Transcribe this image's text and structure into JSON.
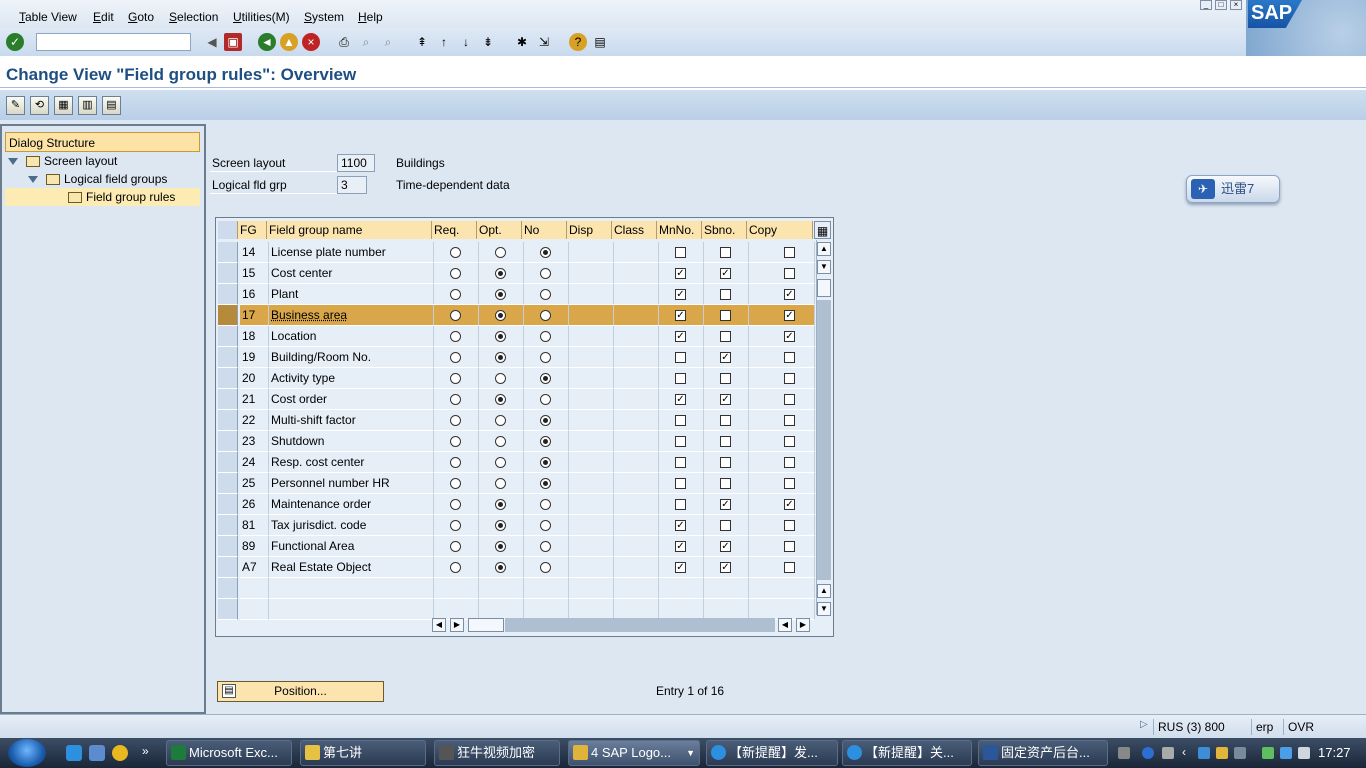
{
  "menu": {
    "items": [
      "Table View",
      "Edit",
      "Goto",
      "Selection",
      "Utilities(M)",
      "System",
      "Help"
    ]
  },
  "brand": {
    "logo_text": "SAP",
    "accent": "#1f4f82"
  },
  "title": "Change View \"Field group rules\": Overview",
  "dialog_structure": {
    "header": "Dialog Structure",
    "items": [
      {
        "label": "Screen layout",
        "level": 0
      },
      {
        "label": "Logical field groups",
        "level": 1
      },
      {
        "label": "Field group rules",
        "level": 2,
        "selected": true
      }
    ]
  },
  "form": {
    "screen_layout_label": "Screen layout",
    "screen_layout_value": "1100",
    "screen_layout_desc": "Buildings",
    "logical_grp_label": "Logical fld grp",
    "logical_grp_value": "3",
    "logical_grp_desc": "Time-dependent data"
  },
  "xunlei": {
    "label": "迅雷7"
  },
  "table": {
    "columns": [
      "FG",
      "Field group name",
      "Req.",
      "Opt.",
      "No",
      "Disp",
      "Class",
      "MnNo.",
      "Sbno.",
      "Copy"
    ],
    "rows": [
      {
        "fg": "14",
        "name": "License plate number",
        "radio": "no",
        "mn": false,
        "sb": false,
        "copy": false
      },
      {
        "fg": "15",
        "name": "Cost center",
        "radio": "opt",
        "mn": true,
        "sb": true,
        "copy": false
      },
      {
        "fg": "16",
        "name": "Plant",
        "radio": "opt",
        "mn": true,
        "sb": false,
        "copy": true
      },
      {
        "fg": "17",
        "name": "Business area",
        "radio": "opt",
        "mn": true,
        "sb": false,
        "copy": true,
        "highlight": true
      },
      {
        "fg": "18",
        "name": "Location",
        "radio": "opt",
        "mn": true,
        "sb": false,
        "copy": true
      },
      {
        "fg": "19",
        "name": "Building/Room No.",
        "radio": "opt",
        "mn": false,
        "sb": true,
        "copy": false
      },
      {
        "fg": "20",
        "name": "Activity type",
        "radio": "no",
        "mn": false,
        "sb": false,
        "copy": false
      },
      {
        "fg": "21",
        "name": "Cost order",
        "radio": "opt",
        "mn": true,
        "sb": true,
        "copy": false
      },
      {
        "fg": "22",
        "name": "Multi-shift factor",
        "radio": "no",
        "mn": false,
        "sb": false,
        "copy": false
      },
      {
        "fg": "23",
        "name": "Shutdown",
        "radio": "no",
        "mn": false,
        "sb": false,
        "copy": false
      },
      {
        "fg": "24",
        "name": "Resp. cost center",
        "radio": "no",
        "mn": false,
        "sb": false,
        "copy": false
      },
      {
        "fg": "25",
        "name": "Personnel number HR",
        "radio": "no",
        "mn": false,
        "sb": false,
        "copy": false
      },
      {
        "fg": "26",
        "name": "Maintenance order",
        "radio": "opt",
        "mn": false,
        "sb": true,
        "copy": true
      },
      {
        "fg": "81",
        "name": "Tax jurisdict. code",
        "radio": "opt",
        "mn": true,
        "sb": false,
        "copy": false
      },
      {
        "fg": "89",
        "name": "Functional Area",
        "radio": "opt",
        "mn": true,
        "sb": true,
        "copy": false
      },
      {
        "fg": "A7",
        "name": "Real Estate Object",
        "radio": "opt",
        "mn": true,
        "sb": true,
        "copy": false
      }
    ]
  },
  "position_button": "Position...",
  "entry_text": "Entry 1 of 16",
  "status": {
    "session": "RUS (3) 800",
    "server": "erp",
    "mode": "OVR"
  },
  "taskbar": {
    "tasks": [
      "Microsoft Exc...",
      "第七讲",
      "狂牛视频加密",
      "4 SAP Logo...",
      "【新提醒】发...",
      "【新提醒】关...",
      "固定资产后台..."
    ],
    "clock": "17:27"
  }
}
